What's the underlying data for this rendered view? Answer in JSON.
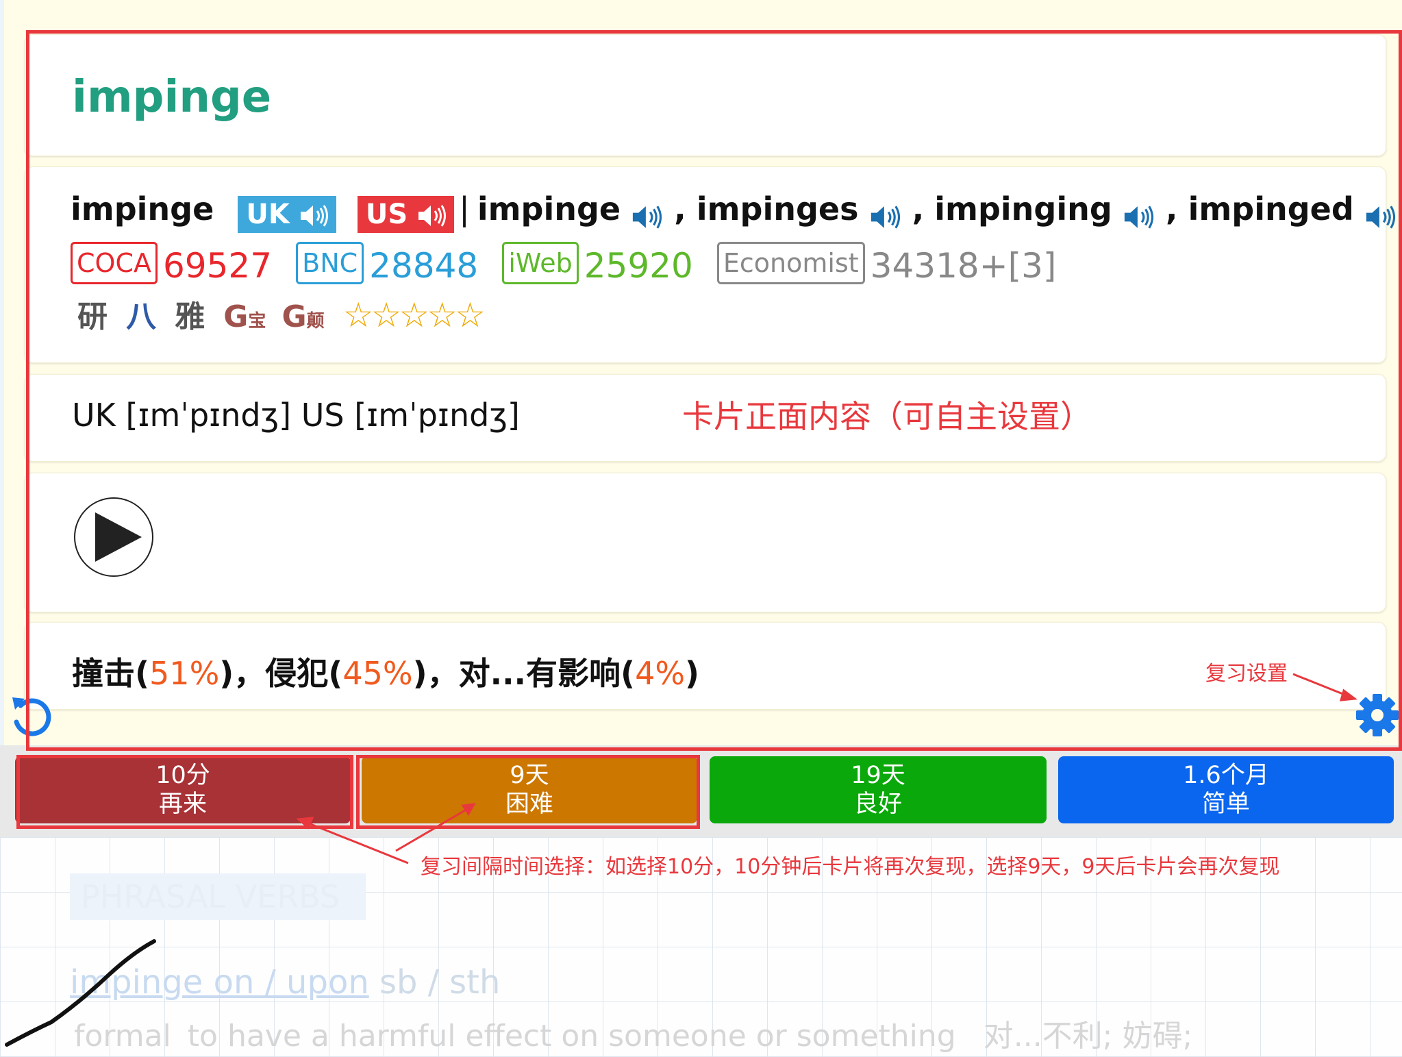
{
  "card": {
    "title": "impinge",
    "headword": "impinge",
    "uk_badge": "UK",
    "us_badge": "US",
    "separator": "|",
    "forms": [
      "impinge",
      "impinges",
      "impinging",
      "impinged"
    ],
    "comma": ",",
    "corpora": [
      {
        "name": "COCA",
        "rank": "69527",
        "color": "#e8262b"
      },
      {
        "name": "BNC",
        "rank": "28848",
        "color": "#2a9ed8"
      },
      {
        "name": "iWeb",
        "rank": "25920",
        "color": "#5db82a"
      },
      {
        "name": "Economist",
        "rank": "34318+[3]",
        "color": "#888888"
      }
    ],
    "exam_tags": [
      "研",
      "八",
      "雅"
    ],
    "g_tags": [
      {
        "main": "G",
        "sub": "宝"
      },
      {
        "main": "G",
        "sub": "颠"
      }
    ],
    "stars": "☆☆☆☆☆",
    "phonetic": "UK [ɪmˈpɪndʒ] US [ɪmˈpɪndʒ]",
    "definition": {
      "parts": [
        {
          "text": "撞击(",
          "hl": false
        },
        {
          "text": "51%",
          "hl": true
        },
        {
          "text": ")，侵犯(",
          "hl": false
        },
        {
          "text": "45%",
          "hl": true
        },
        {
          "text": ")，对...有影响(",
          "hl": false
        },
        {
          "text": "4%",
          "hl": true
        },
        {
          "text": ")",
          "hl": false
        }
      ]
    }
  },
  "buttons": [
    {
      "interval": "10分",
      "label": "再来",
      "color": "#a83236"
    },
    {
      "interval": "9天",
      "label": "困难",
      "color": "#cc7700"
    },
    {
      "interval": "19天",
      "label": "良好",
      "color": "#0aa80a"
    },
    {
      "interval": "1.6个月",
      "label": "简单",
      "color": "#0a66ee"
    }
  ],
  "annotations": {
    "front": "卡片正面内容（可自主设置）",
    "review_settings": "复习设置",
    "interval_note": "复习间隔时间选择：如选择10分，10分钟后卡片将再次复现，选择9天，9天后卡片会再次复现"
  },
  "background": {
    "heading": "PHRASAL VERBS",
    "phrase_part1": "impinge on / upon",
    "phrase_part2": " sb / sth",
    "def_formal": "formal",
    "def_en": "to have a harmful effect on someone or something",
    "def_cn": "对...不利; 妨碍;"
  },
  "icons": {
    "undo": "undo-icon",
    "settings": "gear-icon",
    "play": "play-icon",
    "speaker": "speaker-icon"
  }
}
